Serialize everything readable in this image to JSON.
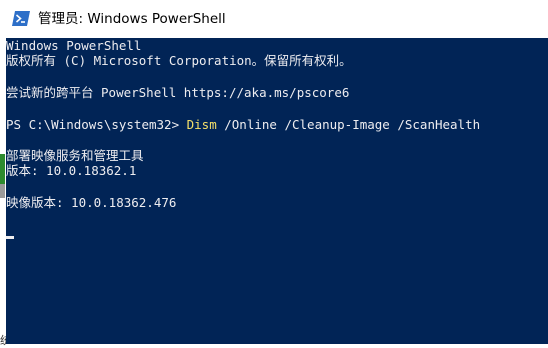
{
  "window": {
    "title": "管理员: Windows PowerShell",
    "icon": "powershell-icon"
  },
  "console": {
    "lines": [
      "Windows PowerShell",
      "版权所有 (C) Microsoft Corporation。保留所有权利。",
      "尝试新的跨平台 PowerShell https://aka.ms/pscore6",
      "PS C:\\Windows\\system32> ",
      "部署映像服务和管理工具",
      "版本: 10.0.18362.1",
      "映像版本: 10.0.18362.476"
    ],
    "command": {
      "keyword": "Dism",
      "args": " /Online /Cleanup-Image /ScanHealth"
    }
  },
  "sidebar": {
    "glyph": "统"
  },
  "colors": {
    "console_bg": "#012456",
    "console_fg": "#eeedf0",
    "command_keyword": "#f5e06a",
    "icon_blue": "#2d6fc8"
  }
}
